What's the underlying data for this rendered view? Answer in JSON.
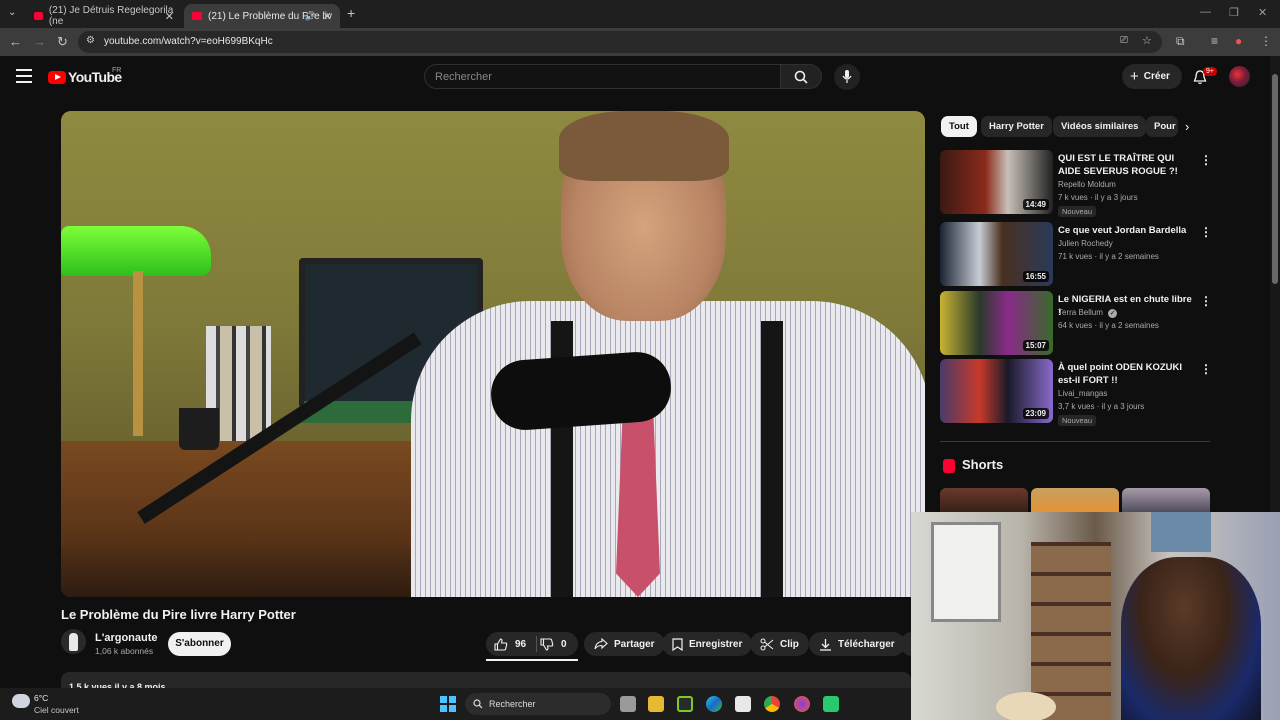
{
  "browser": {
    "tabs": [
      {
        "title": "(21) Je Détruis Regelegorila (ne"
      },
      {
        "title": "(21) Le Problème du Pire liv"
      }
    ],
    "url": "youtube.com/watch?v=eoH699BKqHc"
  },
  "header": {
    "logo_text": "YouTube",
    "region": "FR",
    "search_placeholder": "Rechercher",
    "create_label": "Créer",
    "notif_badge": "9+"
  },
  "video": {
    "title": "Le Problème du Pire livre Harry Potter",
    "channel": "L'argonaute",
    "subscribers": "1,06 k abonnés",
    "subscribe_label": "S'abonner",
    "likes": "96",
    "dislikes": "0",
    "share_label": "Partager",
    "save_label": "Enregistrer",
    "clip_label": "Clip",
    "download_label": "Télécharger",
    "description_meta": "1,5 k vues  il y a 8 mois"
  },
  "sidebar": {
    "chips": [
      "Tout",
      "Harry Potter",
      "Vidéos similaires",
      "Pour"
    ],
    "recommendations": [
      {
        "title": "QUI EST LE TRAÎTRE QUI AIDE SEVERUS ROGUE ?! HARRY ...",
        "channel": "Repello Moldum",
        "meta": "7 k vues · il y a 3 jours",
        "badge": "Nouveau",
        "duration": "14:49"
      },
      {
        "title": "Ce que veut Jordan Bardella",
        "channel": "Julien Rochedy",
        "meta": "71 k vues · il y a 2 semaines",
        "badge": "",
        "duration": "16:55"
      },
      {
        "title": "Le NIGERIA est en chute libre !",
        "channel": "Terra Bellum",
        "meta": "64 k vues · il y a 2 semaines",
        "badge": "",
        "duration": "15:07"
      },
      {
        "title": "À quel point ODEN KOZUKI est-il FORT !!",
        "channel": "Livai_mangas",
        "meta": "3,7 k vues · il y a 3 jours",
        "badge": "Nouveau",
        "duration": "23:09"
      }
    ],
    "shorts_title": "Shorts"
  },
  "taskbar": {
    "temperature": "6°C",
    "weather": "Ciel couvert",
    "search_label": "Rechercher"
  },
  "colors": {
    "background": "#0f0f0f",
    "accent": "#ff0000",
    "chip_active": "#f1f1f1"
  }
}
